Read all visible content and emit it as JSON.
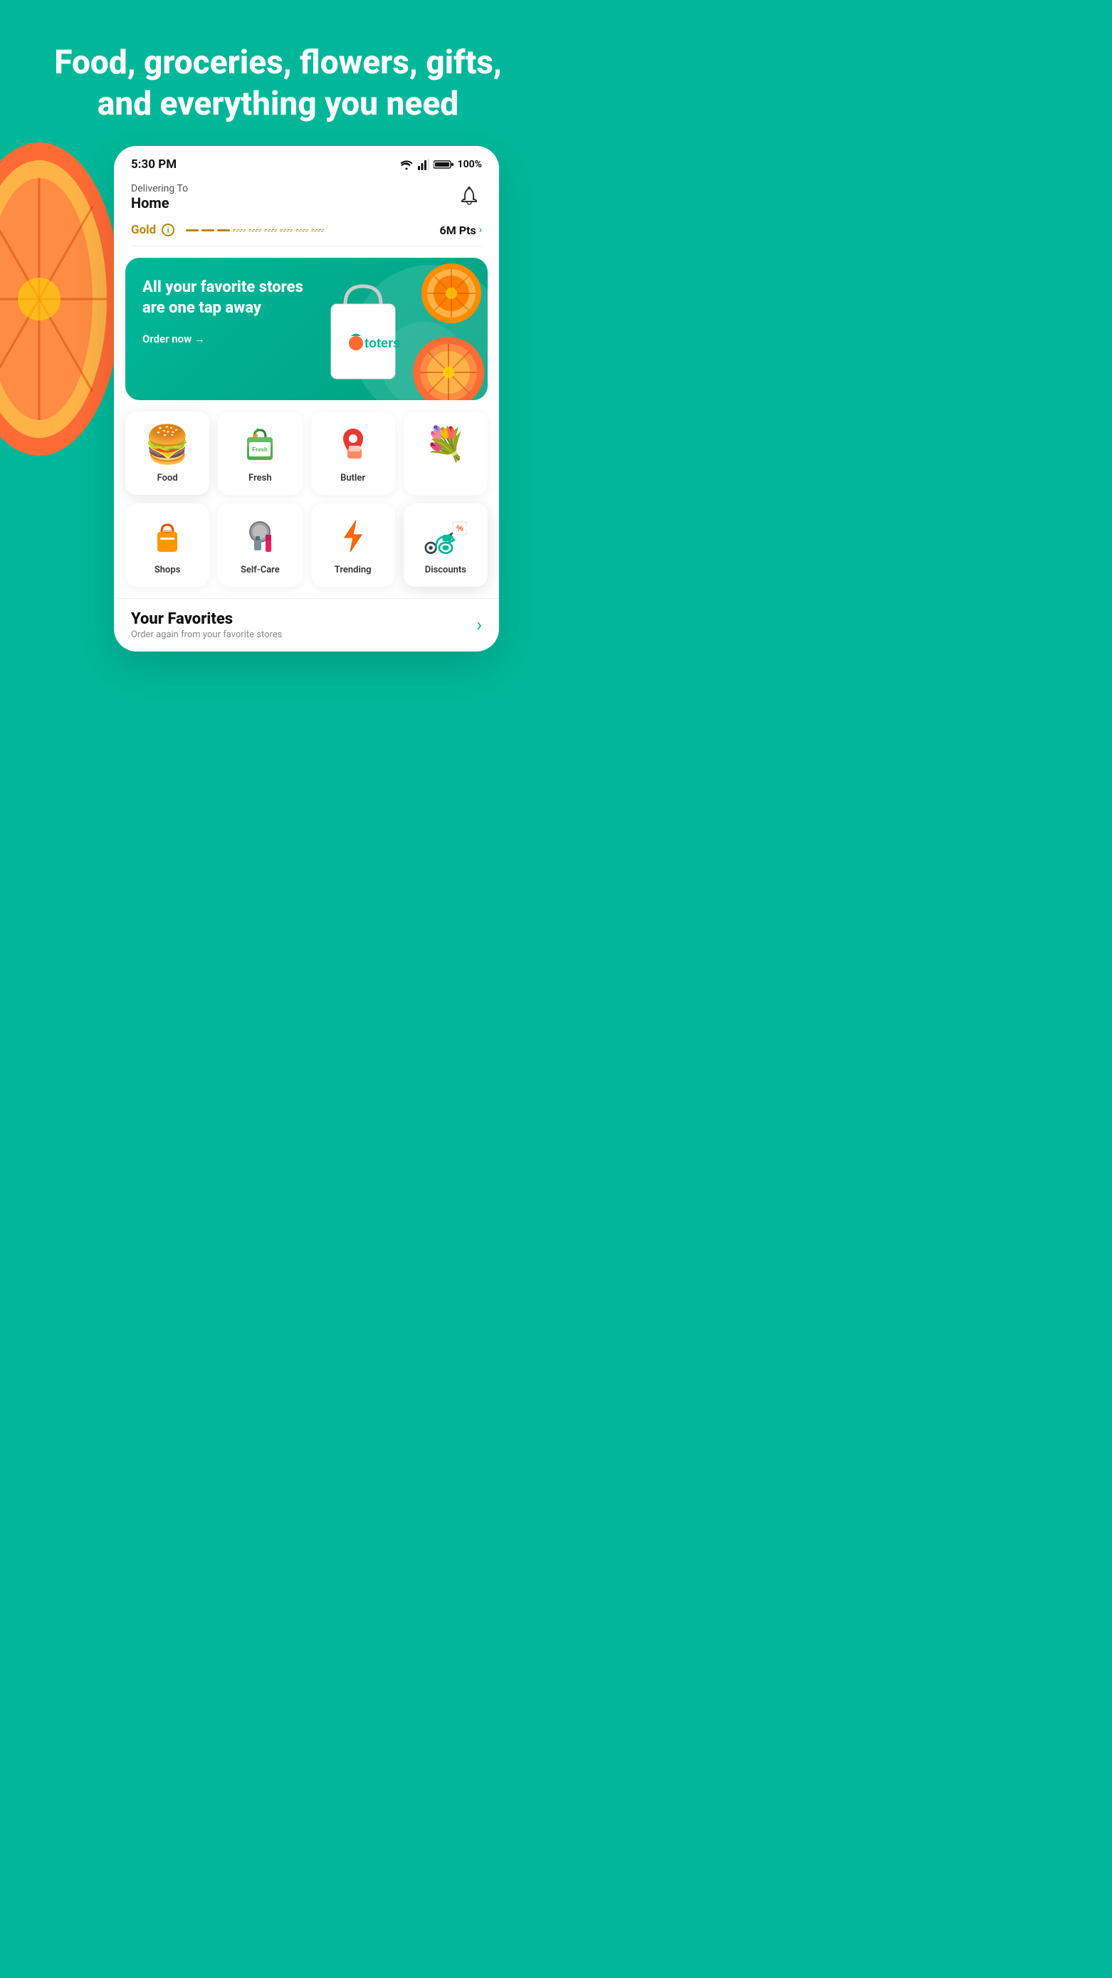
{
  "hero": {
    "text": "Food, groceries, flowers, gifts, and everything you need"
  },
  "statusBar": {
    "time": "5:30 PM",
    "battery": "100%"
  },
  "header": {
    "deliveringLabel": "Delivering To",
    "location": "Home",
    "bellLabel": "notifications"
  },
  "tier": {
    "tierName": "Gold",
    "infoLabel": "i",
    "points": "6M Pts",
    "chevron": "›"
  },
  "banner": {
    "headline": "All your favorite stores are one tap away",
    "cta": "Order now →",
    "brandName": "toters"
  },
  "categories": [
    {
      "id": "food",
      "label": "Food",
      "emoji": "🍔"
    },
    {
      "id": "fresh",
      "label": "Fresh",
      "emoji": "🥗"
    },
    {
      "id": "butler",
      "label": "Butler",
      "emoji": "📦"
    },
    {
      "id": "flowers",
      "label": "",
      "emoji": "💐"
    },
    {
      "id": "shops",
      "label": "Shops",
      "emoji": "🛍️"
    },
    {
      "id": "selfcare",
      "label": "Self-Care",
      "emoji": "💄"
    },
    {
      "id": "trending",
      "label": "Trending",
      "emoji": "⚡"
    },
    {
      "id": "discounts",
      "label": "Discounts",
      "emoji": "🛵"
    }
  ],
  "favorites": {
    "title": "Your Favorites",
    "subtitle": "Order again from your favorite stores",
    "chevron": "›"
  },
  "colors": {
    "primary": "#00B899",
    "gold": "#B8860B",
    "text": "#111111",
    "subtext": "#888888"
  }
}
